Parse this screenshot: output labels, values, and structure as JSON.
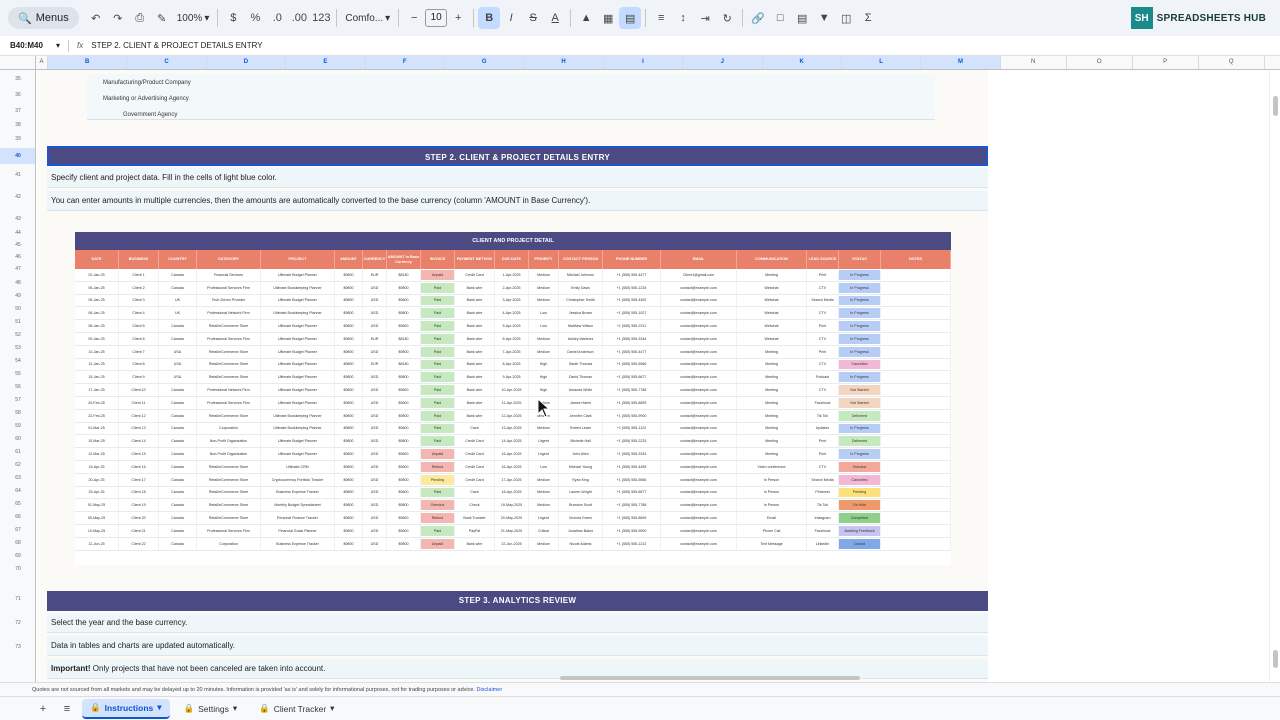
{
  "toolbar": {
    "menus_label": "Menus",
    "zoom": "100%",
    "font": "Comfo...",
    "font_size": "10"
  },
  "brand": {
    "logo_text": "SH",
    "name": "SPREADSHEETS HUB"
  },
  "formula_bar": {
    "name_box": "B40:M40",
    "fx": "fx",
    "content": "STEP 2. CLIENT & PROJECT DETAILS ENTRY"
  },
  "columns": [
    "A",
    "B",
    "C",
    "D",
    "E",
    "F",
    "G",
    "H",
    "I",
    "J",
    "K",
    "L",
    "M",
    "N",
    "O",
    "P",
    "Q"
  ],
  "rows": [
    "35",
    "36",
    "37",
    "38",
    "39",
    "40",
    "41",
    "42",
    "43",
    "44",
    "45",
    "46",
    "47",
    "48",
    "49",
    "50",
    "51",
    "52",
    "53",
    "54",
    "55",
    "56",
    "57",
    "58",
    "59",
    "60",
    "61",
    "62",
    "63",
    "64",
    "65",
    "66",
    "67",
    "68",
    "69",
    "70",
    "71",
    "72",
    "73"
  ],
  "list_items": [
    "Manufacturing/Product Company",
    "Marketing or Advertising Agency",
    "Government Agency"
  ],
  "step2": {
    "title": "STEP 2. CLIENT & PROJECT DETAILS ENTRY",
    "line1": "Specify client and project data. Fill in the cells of light blue color.",
    "line2": "You can enter amounts in multiple currencies, then the amounts are automatically converted to the base currency (column 'AMOUNT in Base Currency')."
  },
  "client_table": {
    "title": "CLIENT AND PROJECT DETAIL",
    "headers": [
      "DATE",
      "BUSINESS",
      "COUNTRY",
      "CATEGORY",
      "PROJECT",
      "AMOUNT",
      "CURRENCY",
      "AMOUNT in Base Currency",
      "INVOICE",
      "PAYMENT METHOD",
      "DUE DATE",
      "PRIORITY",
      "CONTACT PERSON",
      "PHONE NUMBER",
      "EMAIL",
      "COMMUNICATION",
      "LEAD SOURCE",
      "STATUS",
      "NOTES"
    ],
    "rows": [
      [
        "02-Jan-25",
        "Client 1",
        "Canada",
        "Financial Services",
        "Ultimate Budget Planner",
        "$9800",
        "EUR",
        "$8180",
        "Unpaid",
        "Credit Card",
        "1-Apr-2025",
        "Medium",
        "Michael Johnson",
        "+1 (555) 555-4477",
        "Client1@gmail.com",
        "Meeting",
        "Print",
        "In Progress"
      ],
      [
        "05-Jan-25",
        "Client 2",
        "Canada",
        "Professional Services Firm",
        "Ultimate Bookkeeping Planner",
        "$9800",
        "USD",
        "$9800",
        "Paid",
        "Bank wire",
        "2-Apr-2025",
        "Medium",
        "Emily Davis",
        "+1 (555) 555-1234",
        "contact@example.com",
        "Webchat",
        "CTV",
        "In Progress"
      ],
      [
        "05-Jan-25",
        "Client 3",
        "UK",
        "Tech-Driven Provider",
        "Ultimate Budget Planner",
        "$9800",
        "USD",
        "$9800",
        "Paid",
        "Bank wire",
        "3-Apr-2025",
        "Medium",
        "Christopher Smith",
        "+1 (555) 555-4452",
        "contact@example.com",
        "Webchat",
        "Search Media",
        "In Progress"
      ],
      [
        "06-Jan-25",
        "Client 4",
        "UK",
        "Professional Network Firm",
        "Ultimate Bookkeeping Planner",
        "$9800",
        "USD",
        "$9800",
        "Paid",
        "Bank wire",
        "4-Apr-2025",
        "Low",
        "Jessica Brown",
        "+1 (555) 555-1027",
        "contact@example.com",
        "Webchat",
        "CTV",
        "In Progress"
      ],
      [
        "08-Jan-25",
        "Client 5",
        "Canada",
        "Retail/eCommerce Store",
        "Ultimate Budget Planner",
        "$9800",
        "USD",
        "$9800",
        "Paid",
        "Bank wire",
        "5-Apr-2025",
        "Low",
        "Matthew Wilson",
        "+1 (555) 555-2211",
        "contact@example.com",
        "Webchat",
        "Print",
        "In Progress"
      ],
      [
        "09-Jan-25",
        "Client 6",
        "Canada",
        "Professional Services Firm",
        "Ultimate Budget Planner",
        "$9800",
        "EUR",
        "$8180",
        "Paid",
        "Bank wire",
        "6-Apr-2025",
        "Medium",
        "Ashley Martinez",
        "+1 (555) 555-3344",
        "contact@example.com",
        "Webchat",
        "CTV",
        "In Progress"
      ],
      [
        "10-Jan-25",
        "Client 7",
        "USA",
        "Retail/eCommerce Store",
        "Ultimate Budget Planner",
        "$9800",
        "USD",
        "$9800",
        "Paid",
        "Bank wire",
        "7-Apr-2025",
        "Medium",
        "Daniel Anderson",
        "+1 (555) 555-4477",
        "contact@example.com",
        "Meeting",
        "Print",
        "In Progress"
      ],
      [
        "12-Jan-25",
        "Client 8",
        "USA",
        "Retail/eCommerce Store",
        "Ultimate Budget Planner",
        "$9800",
        "EUR",
        "$8180",
        "Paid",
        "Bank wire",
        "8-Apr-2025",
        "High",
        "Sarah Thomas",
        "+1 (555) 555-5566",
        "contact@example.com",
        "Meeting",
        "CTV",
        "Cancelled"
      ],
      [
        "15-Jan-25",
        "Client 9",
        "USA",
        "Retail/eCommerce Store",
        "Ultimate Budget Planner",
        "$9800",
        "USD",
        "$9800",
        "Paid",
        "Bank wire",
        "9-Apr-2025",
        "High",
        "David Thomas",
        "+1 (555) 555-6677",
        "contact@example.com",
        "Meeting",
        "Podcast",
        "In Progress"
      ],
      [
        "17-Jan-25",
        "Client 10",
        "Canada",
        "Professional Network Firm",
        "Ultimate Budget Planner",
        "$9800",
        "USD",
        "$9800",
        "Paid",
        "Bank wire",
        "10-Apr-2025",
        "High",
        "Amanda White",
        "+1 (555) 555-7788",
        "contact@example.com",
        "Meeting",
        "CTV",
        "Not Started"
      ],
      [
        "20-Feb-25",
        "Client 11",
        "Canada",
        "Professional Services Firm",
        "Ultimate Budget Planner",
        "$9800",
        "USD",
        "$9800",
        "Paid",
        "Bank wire",
        "11-Apr-2025",
        "Medium",
        "James Harris",
        "+1 (555) 555-8899",
        "contact@example.com",
        "Meeting",
        "Facebook",
        "Not Started"
      ],
      [
        "22-Feb-25",
        "Client 12",
        "Canada",
        "Retail/eCommerce Store",
        "Ultimate Bookkeeping Planner",
        "$9800",
        "USD",
        "$9800",
        "Paid",
        "Bank wire",
        "12-Apr-2025",
        "Medium",
        "Jennifer Clark",
        "+1 (555) 555-9900",
        "contact@example.com",
        "Meeting",
        "Tik Tok",
        "Delivered"
      ],
      [
        "01-Mar-25",
        "Client 13",
        "Canada",
        "Corporation",
        "Ultimate Bookkeeping Planner",
        "$9800",
        "USD",
        "$9800",
        "Paid",
        "Cash",
        "13-Apr-2025",
        "Medium",
        "Robert Lewis",
        "+1 (555) 555-1122",
        "contact@example.com",
        "Meeting",
        "Updates",
        "In Progress"
      ],
      [
        "10-Mar-25",
        "Client 14",
        "Canada",
        "Non-Profit Organization",
        "Ultimate Budget Planner",
        "$9800",
        "USD",
        "$9800",
        "Paid",
        "Credit Card",
        "14-Apr-2025",
        "Urgent",
        "Michelle Hall",
        "+1 (555) 555-2233",
        "contact@example.com",
        "Meeting",
        "Print",
        "Delivered"
      ],
      [
        "12-Mar-25",
        "Client 15",
        "Canada",
        "Non-Profit Organization",
        "Ultimate Budget Planner",
        "$9800",
        "USD",
        "$9800",
        "Unpaid",
        "Credit Card",
        "15-Apr-2025",
        "Urgent",
        "John Allen",
        "+1 (555) 555-3344",
        "contact@example.com",
        "Meeting",
        "Print",
        "In Progress"
      ],
      [
        "15-Apr-25",
        "Client 16",
        "Canada",
        "Retail/eCommerce Store",
        "Ultimate CRM",
        "$9800",
        "USD",
        "$9800",
        "Refund",
        "Credit Card",
        "16-Apr-2025",
        "Low",
        "Michael Young",
        "+1 (555) 555-4455",
        "contact@example.com",
        "Video conference",
        "CTV",
        "Overdue"
      ],
      [
        "20-Apr-25",
        "Client 17",
        "Canada",
        "Retail/eCommerce Store",
        "Cryptocurrency Portfolio Tracker",
        "$9800",
        "USD",
        "$9800",
        "Pending",
        "Credit Card",
        "17-Apr-2025",
        "Medium",
        "Ryan King",
        "+1 (555) 555-5566",
        "contact@example.com",
        "In Person",
        "Search Media",
        "Cancelled"
      ],
      [
        "25-Apr-25",
        "Client 18",
        "Canada",
        "Retail/eCommerce Store",
        "Business Expense Tracker",
        "$9800",
        "USD",
        "$9800",
        "Paid",
        "Cash",
        "18-Apr-2025",
        "Medium",
        "Lauren Wright",
        "+1 (555) 555-6677",
        "contact@example.com",
        "In Person",
        "Pinterest",
        "Pending"
      ],
      [
        "01-May-25",
        "Client 19",
        "Canada",
        "Retail/eCommerce Store",
        "Monthly Budget Spreadsheet",
        "$9800",
        "USD",
        "$9800",
        "Overdue",
        "Check",
        "19-May-2025",
        "Medium",
        "Brandon Scott",
        "+1 (555) 555-7788",
        "contact@example.com",
        "In Person",
        "Tik Tok",
        "On Hold"
      ],
      [
        "05-May-25",
        "Client 20",
        "Canada",
        "Retail/eCommerce Store",
        "Personal Finance Tracker",
        "$9800",
        "USD",
        "$9800",
        "Refund",
        "Bank Transfer",
        "20-May-2025",
        "Urgent",
        "Victoria Green",
        "+1 (555) 555-8899",
        "contact@example.com",
        "Email",
        "Instagram",
        "Completed"
      ],
      [
        "10-May-25",
        "Client 21",
        "Canada",
        "Professional Services Firm",
        "Financial Goals Planner",
        "$9800",
        "USD",
        "$9800",
        "Paid",
        "PayPal",
        "21-May-2025",
        "Critical",
        "Jonathan Baker",
        "+1 (555) 555-9900",
        "contact@example.com",
        "Phone Call",
        "Facebook",
        "Awaiting Feedback"
      ],
      [
        "12-Jun-25",
        "Client 22",
        "Canada",
        "Corporation",
        "Business Expense Tracker",
        "$9800",
        "USD",
        "$9800",
        "Unpaid",
        "Bank wire",
        "22-Jun-2025",
        "Medium",
        "Nicole Adams",
        "+1 (555) 555-1212",
        "contact@example.com",
        "Text Message",
        "LinkedIn",
        "Closed"
      ]
    ]
  },
  "step3": {
    "title": "STEP 3. ANALYTICS REVIEW",
    "line1": "Select the year and the base currency.",
    "line2": "Data in tables and charts are updated automatically.",
    "line3_bold": "Important!",
    "line3_rest": " Only projects that have not been canceled are taken into account."
  },
  "footer": {
    "note": "Quotes are not sourced from all markets and may be delayed up to 20 minutes. Information is provided 'as is' and solely for informational purposes, not for trading purposes or advice.",
    "disclaimer": "Disclaimer"
  },
  "tabs": [
    {
      "label": "Instructions",
      "active": true
    },
    {
      "label": "Settings",
      "active": false
    },
    {
      "label": "Client Tracker",
      "active": false
    }
  ],
  "colors": {
    "banner": "#4b4a83",
    "table_header": "#e8806a",
    "info_bg": "#eef6fa",
    "invoice_paid": "#c7e9c0",
    "invoice_unpaid": "#f4b6b0",
    "invoice_pending": "#fde9a0",
    "status_progress": "#b8cdf5",
    "status_cancelled": "#f2b8d6",
    "status_delivered": "#c7e9c0",
    "status_overdue": "#f4a89a",
    "status_pending": "#fde07a",
    "status_onhold": "#ef9a6a",
    "status_completed": "#8fd18a",
    "status_awaiting": "#c8c4f0",
    "status_closed": "#7fa8e8",
    "status_notstarted": "#f4d6c0"
  }
}
